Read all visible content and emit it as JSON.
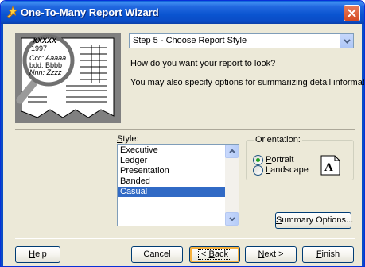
{
  "window": {
    "title": "One-To-Many Report Wizard",
    "title_icon": "wand-icon",
    "close_icon": "close-icon"
  },
  "illustration": {
    "icon": "magnifier-report-icon",
    "lines": [
      "XXXXX",
      "1997",
      "Ccc: Aaaaa",
      "bdd: Bbbb",
      "Nnn: Zzzz"
    ]
  },
  "step_combo": {
    "value": "Step 5 - Choose Report Style"
  },
  "prompt": {
    "line1": "How do you want your report to look?",
    "line2": "You may also specify options for summarizing detail information."
  },
  "style": {
    "label_pre": "",
    "label_accel": "S",
    "label_post": "tyle:",
    "items": [
      "Executive",
      "Ledger",
      "Presentation",
      "Banded",
      "Casual"
    ],
    "selected": "Casual"
  },
  "orientation": {
    "legend": "Orientation:",
    "portrait_accel": "P",
    "portrait_rest": "ortrait",
    "landscape_accel": "L",
    "landscape_rest": "andscape",
    "selected": "Portrait",
    "preview_letter": "A"
  },
  "buttons": {
    "summary_accel": "S",
    "summary_rest": "ummary Options...",
    "help_accel": "H",
    "help_rest": "elp",
    "cancel": "Cancel",
    "back_pre": "< ",
    "back_accel": "B",
    "back_rest": "ack",
    "next_accel": "N",
    "next_rest": "ext >",
    "finish_accel": "F",
    "finish_rest": "inish"
  },
  "colors": {
    "title_bar": "#0a54d0",
    "selection": "#316ac5",
    "dialog_bg": "#ece9d8"
  }
}
